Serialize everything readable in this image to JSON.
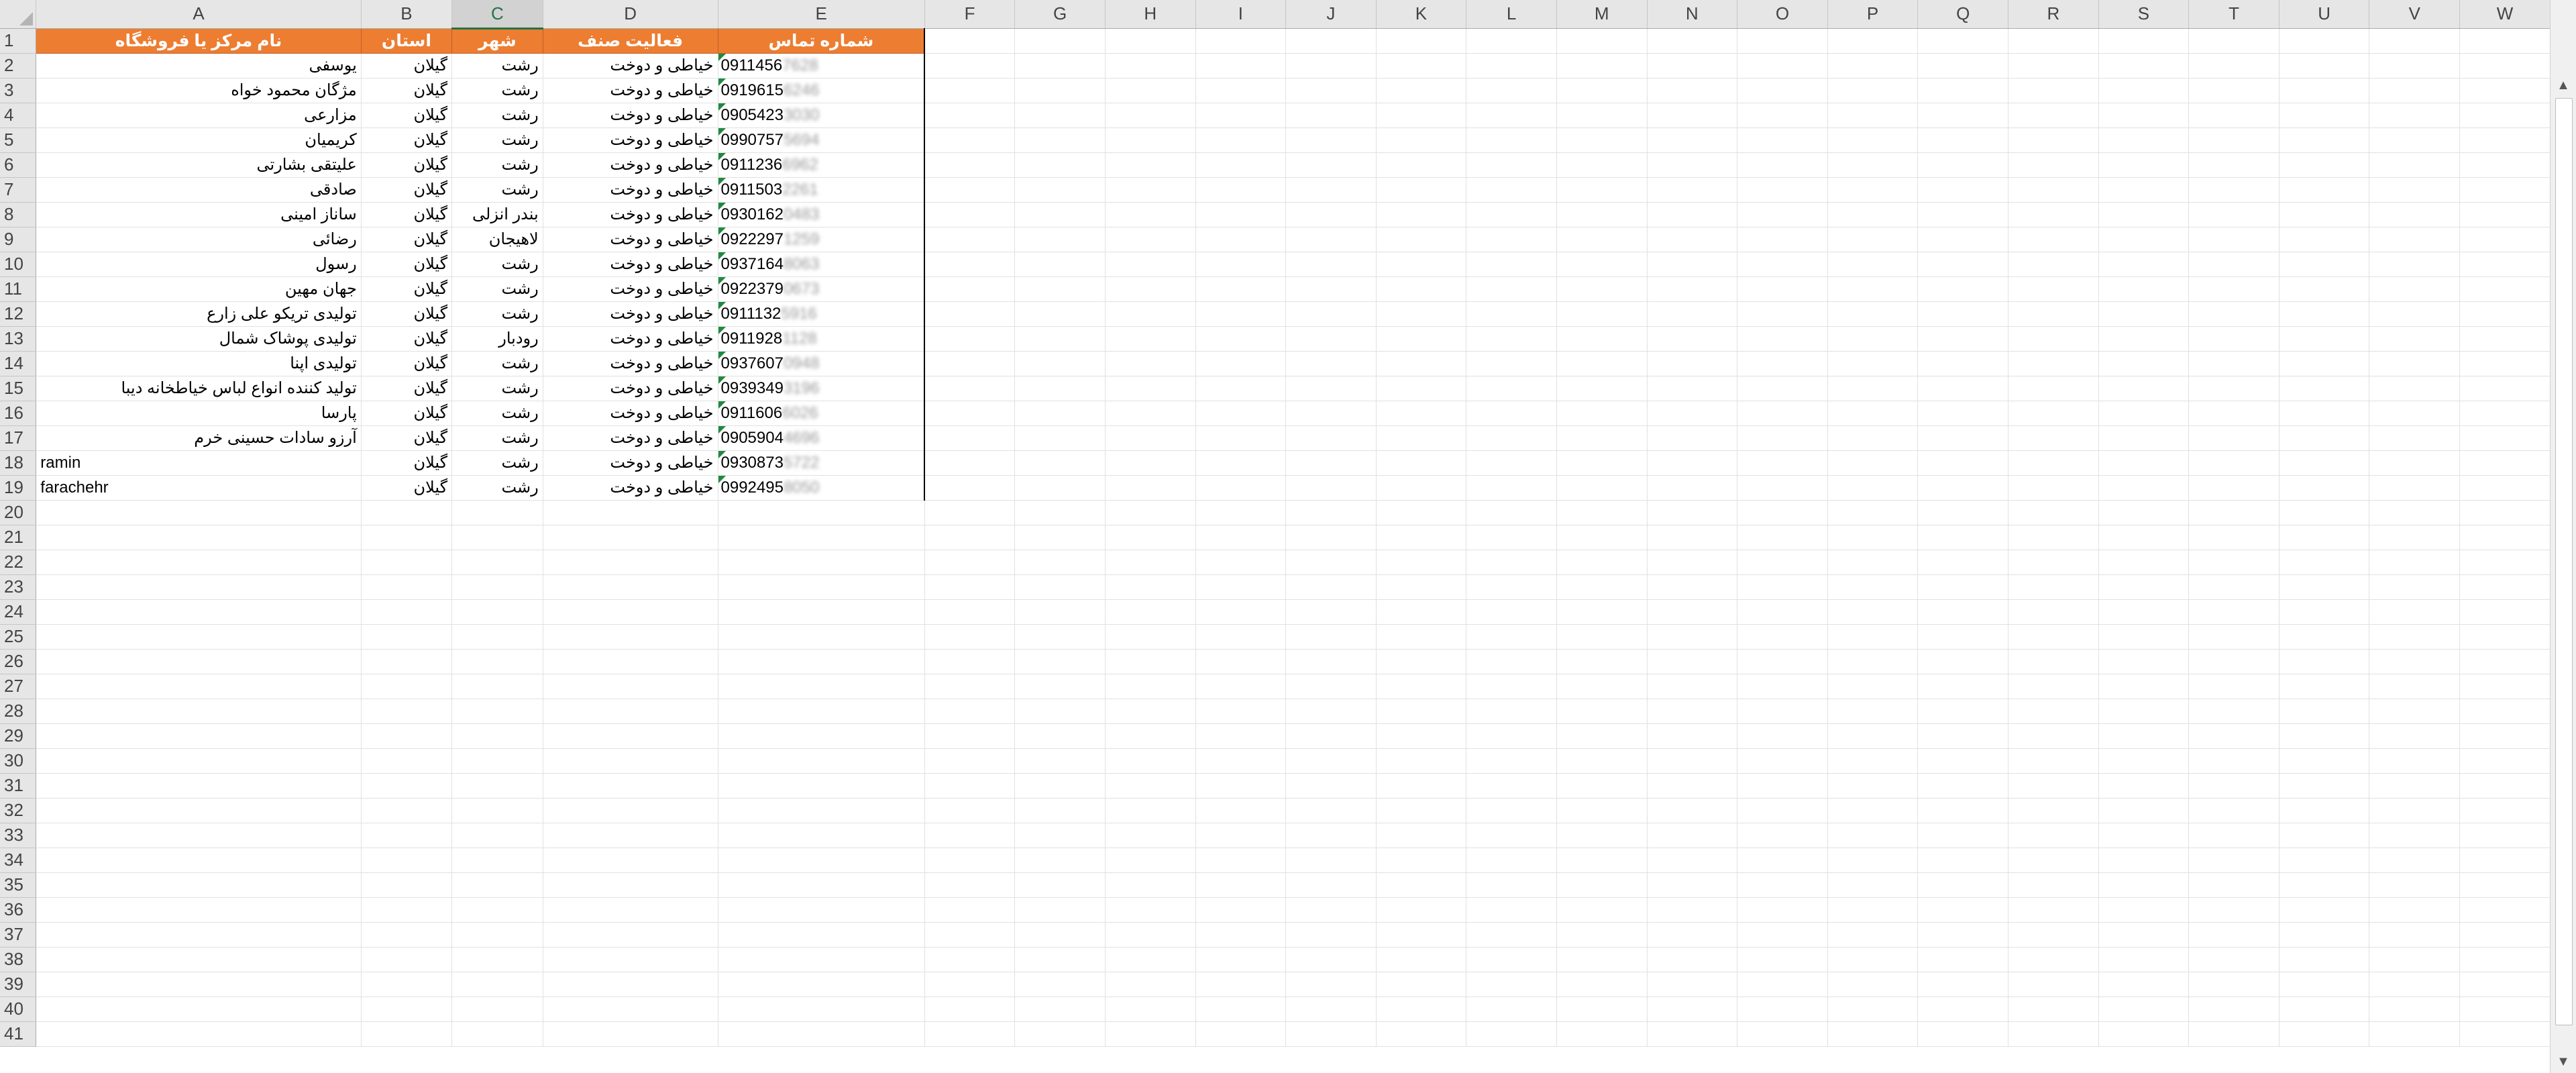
{
  "column_letters": [
    "A",
    "B",
    "C",
    "D",
    "E",
    "F",
    "G",
    "H",
    "I",
    "J",
    "K",
    "L",
    "M",
    "N",
    "O",
    "P",
    "Q",
    "R",
    "S",
    "T",
    "U",
    "V",
    "W"
  ],
  "selected_column": "C",
  "header_row": {
    "row": "1",
    "cells": [
      "نام مرکز یا فروشگاه",
      "استان",
      "شهر",
      "فعالیت صنف",
      "شماره تماس"
    ]
  },
  "data_rows": [
    {
      "row": "2",
      "name": "یوسفی",
      "province": "گیلان",
      "city": "رشت",
      "activity": "خیاطی و دوخت",
      "phone": "0911456",
      "phone_hidden": "7628"
    },
    {
      "row": "3",
      "name": "مژگان محمود خواه",
      "province": "گیلان",
      "city": "رشت",
      "activity": "خیاطی و دوخت",
      "phone": "0919615",
      "phone_hidden": "6246"
    },
    {
      "row": "4",
      "name": "مزارعی",
      "province": "گیلان",
      "city": "رشت",
      "activity": "خیاطی و دوخت",
      "phone": "0905423",
      "phone_hidden": "3030"
    },
    {
      "row": "5",
      "name": "کریمیان",
      "province": "گیلان",
      "city": "رشت",
      "activity": "خیاطی و دوخت",
      "phone": "0990757",
      "phone_hidden": "5694"
    },
    {
      "row": "6",
      "name": "علیتقی  بشارتی",
      "province": "گیلان",
      "city": "رشت",
      "activity": "خیاطی و دوخت",
      "phone": "0911236",
      "phone_hidden": "6962"
    },
    {
      "row": "7",
      "name": "صادقی",
      "province": "گیلان",
      "city": "رشت",
      "activity": "خیاطی و دوخت",
      "phone": "0911503",
      "phone_hidden": "2261"
    },
    {
      "row": "8",
      "name": "ساناز امینی",
      "province": "گیلان",
      "city": "بندر انزلی",
      "activity": "خیاطی و دوخت",
      "phone": "0930162",
      "phone_hidden": "0483"
    },
    {
      "row": "9",
      "name": "رضائی",
      "province": "گیلان",
      "city": "لاهیجان",
      "activity": "خیاطی و دوخت",
      "phone": "0922297",
      "phone_hidden": "1259"
    },
    {
      "row": "10",
      "name": "رسول",
      "province": "گیلان",
      "city": "رشت",
      "activity": "خیاطی و دوخت",
      "phone": "0937164",
      "phone_hidden": "8063"
    },
    {
      "row": "11",
      "name": "جهان مهین",
      "province": "گیلان",
      "city": "رشت",
      "activity": "خیاطی و دوخت",
      "phone": "0922379",
      "phone_hidden": "0673"
    },
    {
      "row": "12",
      "name": "تولیدی تریکو علی زارع",
      "province": "گیلان",
      "city": "رشت",
      "activity": "خیاطی و دوخت",
      "phone": "0911132",
      "phone_hidden": "5916"
    },
    {
      "row": "13",
      "name": "تولیدی پوشاک شمال",
      "province": "گیلان",
      "city": "رودبار",
      "activity": "خیاطی و دوخت",
      "phone": "0911928",
      "phone_hidden": "1128"
    },
    {
      "row": "14",
      "name": "تولیدی اپنا",
      "province": "گیلان",
      "city": "رشت",
      "activity": "خیاطی و دوخت",
      "phone": "0937607",
      "phone_hidden": "0948"
    },
    {
      "row": "15",
      "name": "تولید کننده انواع لباس خیاطخانه دیبا",
      "province": "گیلان",
      "city": "رشت",
      "activity": "خیاطی و دوخت",
      "phone": "0939349",
      "phone_hidden": "3196"
    },
    {
      "row": "16",
      "name": "پارسا",
      "province": "گیلان",
      "city": "رشت",
      "activity": "خیاطی و دوخت",
      "phone": "0911606",
      "phone_hidden": "6026"
    },
    {
      "row": "17",
      "name": "آرزو سادات حسینی خرم",
      "province": "گیلان",
      "city": "رشت",
      "activity": "خیاطی و دوخت",
      "phone": "0905904",
      "phone_hidden": "4696"
    },
    {
      "row": "18",
      "name": "ramin",
      "province": "گیلان",
      "city": "رشت",
      "activity": "خیاطی و دوخت",
      "phone": "0930873",
      "phone_hidden": "5722"
    },
    {
      "row": "19",
      "name": "farachehr",
      "province": "گیلان",
      "city": "رشت",
      "activity": "خیاطی و دوخت",
      "phone": "0992495",
      "phone_hidden": "8050"
    }
  ],
  "empty_rows": [
    "20",
    "21",
    "22",
    "23",
    "24",
    "25",
    "26",
    "27",
    "28",
    "29",
    "30",
    "31",
    "32",
    "33",
    "34",
    "35",
    "36",
    "37",
    "38",
    "39",
    "40",
    "41"
  ],
  "colors": {
    "header_fill": "#ed7d31",
    "header_text": "#ffffff",
    "selected_column_accent": "#217346",
    "comment_marker": "#1e8a3e"
  },
  "icons": {
    "scroll_up": "triangle-up-icon",
    "scroll_down": "triangle-down-icon",
    "select_all": "select-all-triangle-icon"
  }
}
